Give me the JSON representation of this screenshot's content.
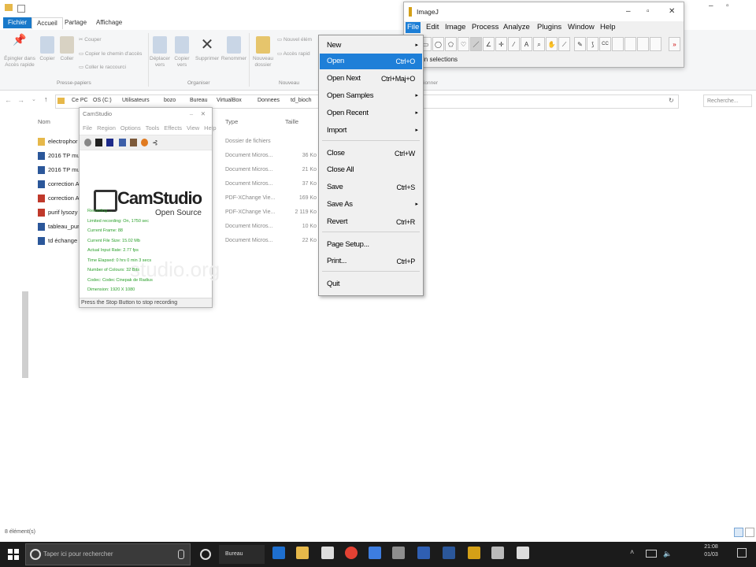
{
  "explorer": {
    "tabs": {
      "file": "Fichier",
      "home": "Accueil",
      "share": "Partage",
      "view": "Affichage"
    },
    "ribbon": {
      "pin": "Épingler dans Accès rapide",
      "copy": "Copier",
      "paste": "Coller",
      "cut": "Couper",
      "copy_path": "Copier le chemin d'accès",
      "paste_shortcut": "Coller le raccourci",
      "move_to": "Déplacer vers",
      "copy_to": "Copier vers",
      "delete": "Supprimer",
      "rename": "Renommer",
      "new_folder": "Nouveau dossier",
      "new_item": "Nouvel élém",
      "easy_access": "Accès rapid",
      "group_clipboard": "Presse-papiers",
      "group_organize": "Organiser",
      "group_new": "Nouveau",
      "group_select": "ionner"
    },
    "breadcrumb": [
      "Ce PC",
      "OS (C:)",
      "Utilisateurs",
      "bozo",
      "Bureau",
      "VirtualBox",
      "Donnees",
      "td_bioch"
    ],
    "search_placeholder": "Recherche...",
    "columns": {
      "name": "Nom",
      "type": "Type",
      "size": "Taille"
    },
    "files": [
      {
        "name": "electrophor",
        "type": "Dossier de fichiers",
        "size": ""
      },
      {
        "name": "2016 TP mu",
        "type": "Document Micros...",
        "size": "36 Ko"
      },
      {
        "name": "2016 TP mu",
        "type": "Document Micros...",
        "size": "21 Ko"
      },
      {
        "name": "correction A",
        "type": "Document Micros...",
        "size": "37 Ko"
      },
      {
        "name": "correction A",
        "type": "PDF-XChange Vie...",
        "size": "169 Ko"
      },
      {
        "name": "purif lysozy",
        "type": "PDF-XChange Vie...",
        "size": "2 119 Ko"
      },
      {
        "name": "tableau_puri",
        "type": "Document Micros...",
        "size": "10 Ko"
      },
      {
        "name": "td échange",
        "type": "Document Micros...",
        "size": "22 Ko"
      }
    ],
    "status": "8 élément(s)"
  },
  "camstudio": {
    "title": "CamStudio",
    "menu": [
      "File",
      "Region",
      "Options",
      "Tools",
      "Effects",
      "View",
      "Help"
    ],
    "logo": "CamStudio",
    "logo_sub": "Open Source",
    "watermark": "studio.org",
    "stats": [
      "Recording ...",
      "Limited recording: On, 1750 sec",
      "Current Frame: 88",
      "Current File Size: 15.02 Mb",
      "Actual Input Rate: 2.77 fps",
      "Time Elapsed: 0 hrs 0 min 3 secs",
      "Number of Colours: 32 Bits",
      "Codec: Codec Cinepak de Radius",
      "Dimension: 1920 X 1080"
    ],
    "status": "Press the Stop Button to stop recording"
  },
  "imagej": {
    "title": "ImageJ",
    "menu": [
      "File",
      "Edit",
      "Image",
      "Process",
      "Analyze",
      "Plugins",
      "Window",
      "Help"
    ],
    "status": "in selections",
    "file_menu": [
      {
        "label": "New",
        "shortcut": "",
        "submenu": true
      },
      {
        "label": "Open",
        "shortcut": "Ctrl+O",
        "submenu": false,
        "highlighted": true
      },
      {
        "label": "Open Next",
        "shortcut": "Ctrl+Maj+O",
        "submenu": false
      },
      {
        "label": "Open Samples",
        "shortcut": "",
        "submenu": true
      },
      {
        "label": "Open Recent",
        "shortcut": "",
        "submenu": true
      },
      {
        "label": "Import",
        "shortcut": "",
        "submenu": true
      },
      {
        "label": "Close",
        "shortcut": "Ctrl+W",
        "submenu": false
      },
      {
        "label": "Close All",
        "shortcut": "",
        "submenu": false
      },
      {
        "label": "Save",
        "shortcut": "Ctrl+S",
        "submenu": false
      },
      {
        "label": "Save As",
        "shortcut": "",
        "submenu": true
      },
      {
        "label": "Revert",
        "shortcut": "Ctrl+R",
        "submenu": false
      },
      {
        "label": "Page Setup...",
        "shortcut": "",
        "submenu": false
      },
      {
        "label": "Print...",
        "shortcut": "Ctrl+P",
        "submenu": false
      },
      {
        "label": "Quit",
        "shortcut": "",
        "submenu": false
      }
    ]
  },
  "taskbar": {
    "search_placeholder": "Taper ici pour rechercher",
    "app_label": "Bureau",
    "time": "21:08",
    "date": "01/03"
  },
  "colors": {
    "accent": "#1e7fd8",
    "file_tab": "#1979ca",
    "cam_green": "#2aa02a",
    "taskbar": "#1b1b1b"
  }
}
